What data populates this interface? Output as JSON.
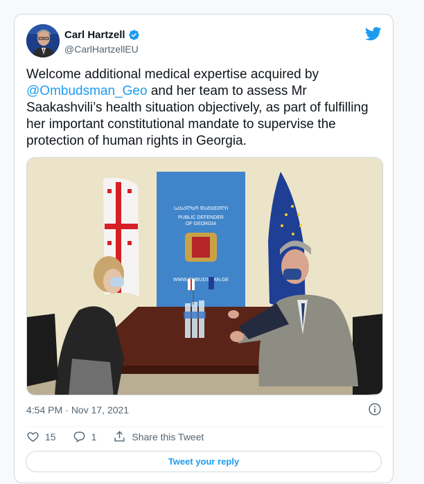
{
  "author": {
    "name": "Carl Hartzell",
    "handle": "@CarlHartzellEU",
    "verified": true
  },
  "tweet": {
    "text_before": "Welcome additional medical expertise acquired by ",
    "mention": "@Ombudsman_Geo",
    "text_after": " and her team to assess Mr Saakashvili’s health situation objectively, as part of fulfilling her important constitutional mandate to supervise the protection of human rights in Georgia.",
    "time": "4:54 PM",
    "separator": "·",
    "date": "Nov 17, 2021"
  },
  "photo": {
    "banner_lines": [
      "PUBLIC DEFENDER",
      "OF GEORGIA"
    ],
    "banner_url": "WWW.OMBUDSMAN.GE"
  },
  "actions": {
    "likes": "15",
    "replies": "1",
    "share_label": "Share this Tweet"
  },
  "reply_button": "Tweet your reply",
  "colors": {
    "accent": "#1d9bf0",
    "text": "#0f1419",
    "muted": "#536471"
  },
  "icons": [
    "twitter-bird-icon",
    "verified-badge-icon",
    "info-icon",
    "heart-icon",
    "reply-icon",
    "share-icon"
  ]
}
